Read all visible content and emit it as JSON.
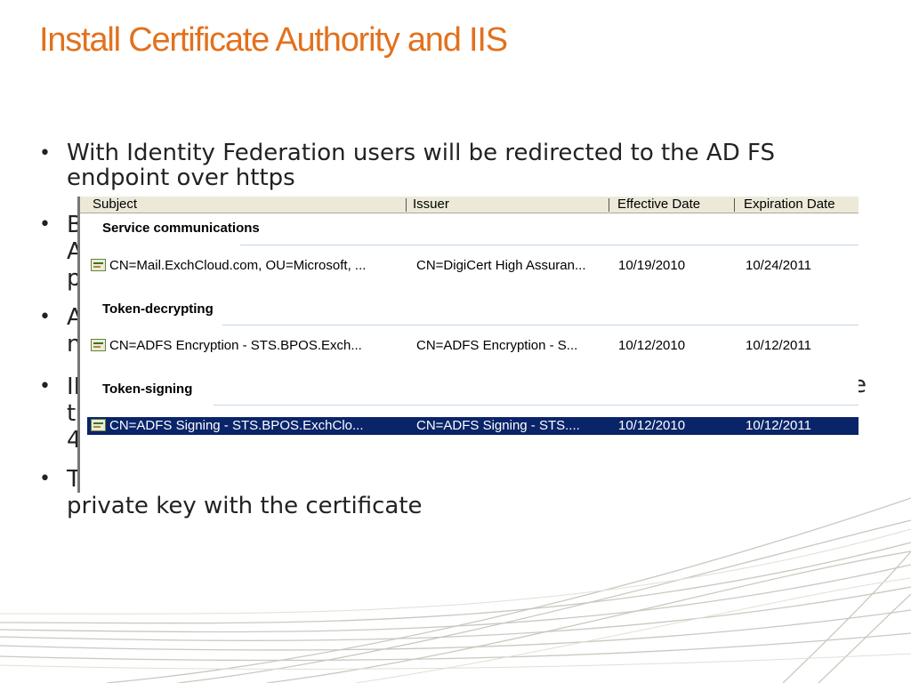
{
  "slide": {
    "title": "Install Certificate Authority and IIS",
    "bullets": [
      {
        "text": "With Identity Federation users will be redirected to the AD FS\nendpoint over https"
      },
      {
        "text": "B\nA\np"
      },
      {
        "text": "A\nn"
      },
      {
        "text": "II\nt\n4"
      },
      {
        "text": "T\nprivate key with the certificate"
      }
    ],
    "right_fragments": [
      ":",
      "e",
      "ʼ"
    ]
  },
  "cert_list": {
    "columns": [
      "Subject",
      "Issuer",
      "Effective Date",
      "Expiration Date"
    ],
    "groups": [
      {
        "label": "Service communications",
        "row": {
          "subject": "CN=Mail.ExchCloud.com, OU=Microsoft, ...",
          "issuer": "CN=DigiCert High Assuran...",
          "effective": "10/19/2010",
          "expiration": "10/24/2011"
        }
      },
      {
        "label": "Token-decrypting",
        "row": {
          "subject": "CN=ADFS Encryption - STS.BPOS.Exch...",
          "issuer": "CN=ADFS Encryption - S...",
          "effective": "10/12/2010",
          "expiration": "10/12/2011"
        }
      },
      {
        "label": "Token-signing",
        "row": {
          "subject": "CN=ADFS Signing - STS.BPOS.ExchClo...",
          "issuer": "CN=ADFS Signing - STS....",
          "effective": "10/12/2010",
          "expiration": "10/12/2011"
        }
      }
    ]
  }
}
